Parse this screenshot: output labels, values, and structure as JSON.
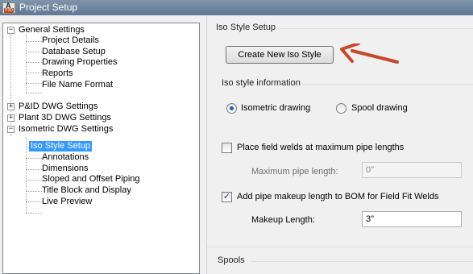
{
  "window": {
    "title": "Project Setup",
    "icon_letter": "A",
    "icon_badge": "P3D"
  },
  "tree": {
    "general": {
      "label": "General Settings",
      "children": [
        "Project Details",
        "Database Setup",
        "Drawing Properties",
        "Reports",
        "File Name Format"
      ]
    },
    "pid": {
      "label": "P&ID DWG Settings"
    },
    "plant3d": {
      "label": "Plant 3D DWG Settings"
    },
    "iso": {
      "label": "Isometric DWG Settings",
      "children": [
        "Iso Style Setup",
        "Annotations",
        "Dimensions",
        "Sloped and Offset Piping",
        "Title Block and Display",
        "Live Preview"
      ],
      "selected": "Iso Style Setup"
    },
    "expander_expanded": "−",
    "expander_collapsed": "+"
  },
  "panel": {
    "header": "Iso Style Setup",
    "create_button": "Create New Iso Style",
    "iso_info_label": "Iso style information",
    "radio_isometric": "Isometric drawing",
    "radio_spool": "Spool drawing",
    "radio_selected": "isometric",
    "place_welds_label": "Place field welds at maximum pipe lengths",
    "place_welds_checked": false,
    "max_pipe_label": "Maximum pipe length:",
    "max_pipe_value": "0\"",
    "add_makeup_label": "Add pipe makeup length to BOM for Field Fit Welds",
    "add_makeup_checked": true,
    "checkmark": "✓",
    "makeup_label": "Makeup Length:",
    "makeup_value": "3\"",
    "spools_label": "Spools"
  },
  "colors": {
    "selection": "#3399ff",
    "annotation_arrow": "#c8472a"
  },
  "icons": {
    "annotation": "red-arrow-icon"
  }
}
